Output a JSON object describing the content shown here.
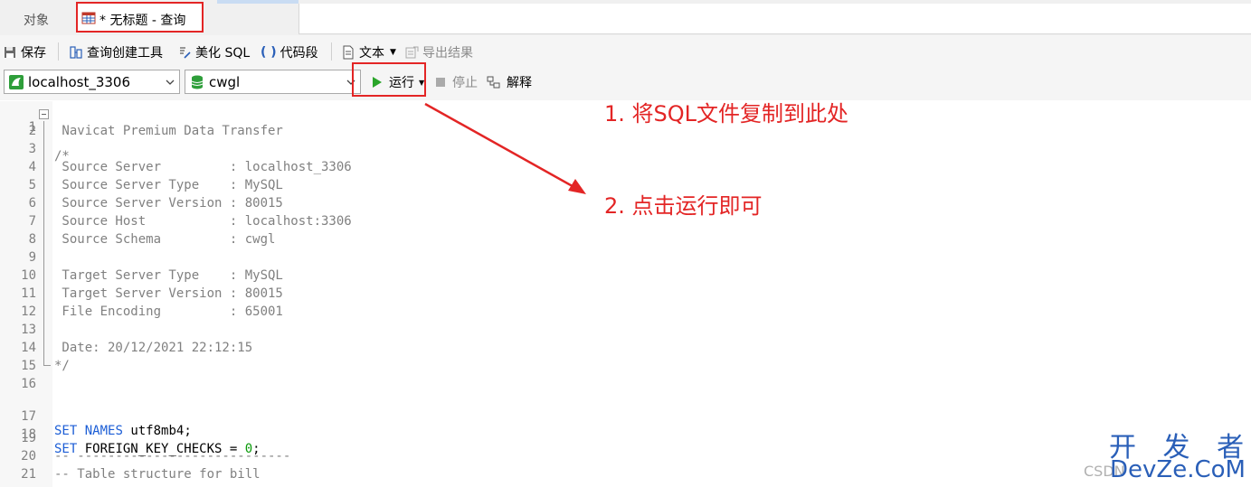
{
  "tabs": {
    "objects_label": "对象",
    "query_label": "* 无标题 - 查询"
  },
  "toolbar1": {
    "save": "保存",
    "query_builder": "查询创建工具",
    "beautify": "美化 SQL",
    "snippet": "代码段",
    "text": "文本",
    "export": "导出结果"
  },
  "toolbar2": {
    "connection": "localhost_3306",
    "database": "cwgl",
    "run": "运行",
    "stop": "停止",
    "explain": "解释"
  },
  "colors": {
    "annotation_red": "#e32525",
    "keyword_blue": "#1c5ed6",
    "comment_gray": "#808080",
    "number_green": "#0a9a0a",
    "run_green": "#2aa52a",
    "connection_green": "#2e9e3a"
  },
  "editor": {
    "lines": [
      {
        "n": "1",
        "t": "/*"
      },
      {
        "n": "2",
        "t": " Navicat Premium Data Transfer"
      },
      {
        "n": "3",
        "t": ""
      },
      {
        "n": "4",
        "t": " Source Server         : localhost_3306"
      },
      {
        "n": "5",
        "t": " Source Server Type    : MySQL"
      },
      {
        "n": "6",
        "t": " Source Server Version : 80015"
      },
      {
        "n": "7",
        "t": " Source Host           : localhost:3306"
      },
      {
        "n": "8",
        "t": " Source Schema         : cwgl"
      },
      {
        "n": "9",
        "t": ""
      },
      {
        "n": "10",
        "t": " Target Server Type    : MySQL"
      },
      {
        "n": "11",
        "t": " Target Server Version : 80015"
      },
      {
        "n": "12",
        "t": " File Encoding         : 65001"
      },
      {
        "n": "13",
        "t": ""
      },
      {
        "n": "14",
        "t": " Date: 20/12/2021 22:12:15"
      },
      {
        "n": "15",
        "t": "*/"
      },
      {
        "n": "16",
        "t": ""
      },
      {
        "n": "17",
        "kw1": "SET",
        "kw2": "NAMES",
        "rest": " utf8mb4;"
      },
      {
        "n": "18",
        "kw1": "SET",
        "plain": " FOREIGN_KEY_CHECKS = ",
        "num": "0",
        "end": ";"
      },
      {
        "n": "19",
        "t": ""
      },
      {
        "n": "20",
        "t": "-- ----------------------------"
      },
      {
        "n": "21",
        "t": "-- Table structure for bill"
      }
    ]
  },
  "annotations": {
    "step1": "1. 将SQL文件复制到此处",
    "step2": "2. 点击运行即可"
  },
  "watermark": {
    "big": "开 发 者",
    "small": "DevZe.CoM",
    "csdn": "CSDN"
  }
}
